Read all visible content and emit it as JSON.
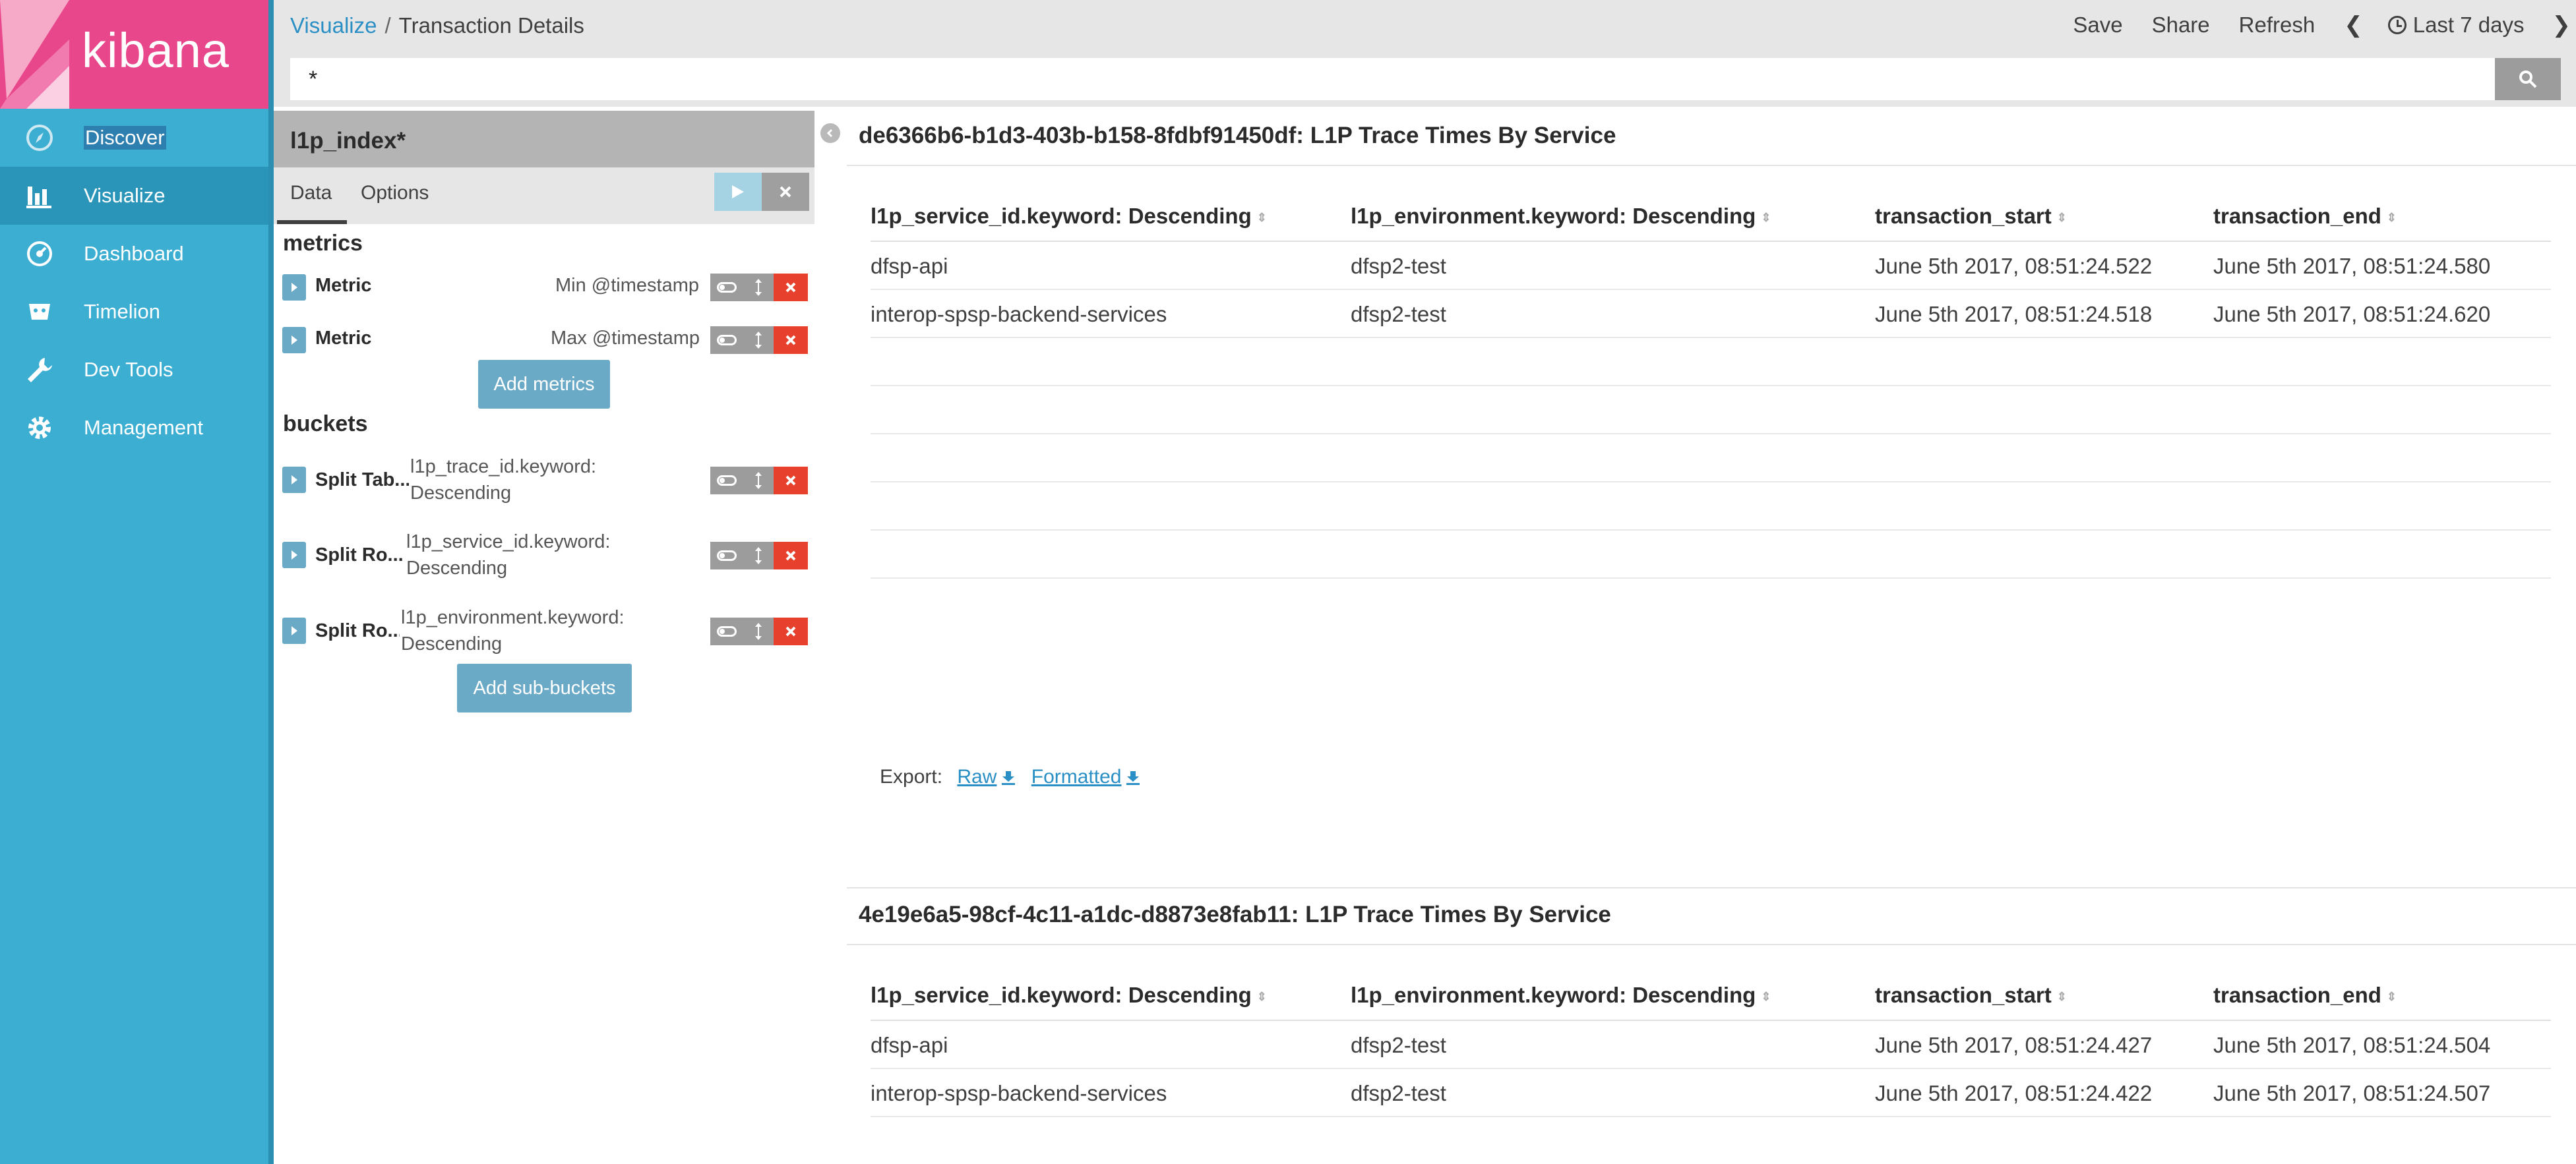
{
  "app": {
    "logo_text": "kibana"
  },
  "nav": {
    "items": [
      {
        "label": "Discover",
        "icon": "compass-icon"
      },
      {
        "label": "Visualize",
        "icon": "bar-chart-icon"
      },
      {
        "label": "Dashboard",
        "icon": "dashboard-icon"
      },
      {
        "label": "Timelion",
        "icon": "timelion-icon"
      },
      {
        "label": "Dev Tools",
        "icon": "wrench-icon"
      },
      {
        "label": "Management",
        "icon": "gear-icon"
      }
    ]
  },
  "breadcrumb": {
    "parent": "Visualize",
    "separator": "/",
    "current": "Transaction Details"
  },
  "toolbar": {
    "save": "Save",
    "share": "Share",
    "refresh": "Refresh",
    "prev": "❮",
    "time": "Last 7 days",
    "next": "❯"
  },
  "query": {
    "value": "*"
  },
  "editor": {
    "index": "l1p_index*",
    "tabs": {
      "data": "Data",
      "options": "Options"
    },
    "metrics_title": "metrics",
    "metrics": [
      {
        "name": "Metric",
        "desc": "Min @timestamp"
      },
      {
        "name": "Metric",
        "desc": "Max @timestamp"
      }
    ],
    "add_metrics": "Add metrics",
    "buckets_title": "buckets",
    "buckets": [
      {
        "name": "Split Tab...",
        "desc1": "l1p_trace_id.keyword:",
        "desc2": "Descending"
      },
      {
        "name": "Split Ro...",
        "desc1": "l1p_service_id.keyword:",
        "desc2": "Descending"
      },
      {
        "name": "Split Ro...",
        "desc1": "l1p_environment.keyword:",
        "desc2": "Descending"
      }
    ],
    "add_buckets": "Add sub-buckets"
  },
  "results": [
    {
      "title": "de6366b6-b1d3-403b-b158-8fdbf91450df: L1P Trace Times By Service",
      "columns": [
        "l1p_service_id.keyword: Descending",
        "l1p_environment.keyword: Descending",
        "transaction_start",
        "transaction_end"
      ],
      "rows": [
        [
          "dfsp-api",
          "dfsp2-test",
          "June 5th 2017, 08:51:24.522",
          "June 5th 2017, 08:51:24.580"
        ],
        [
          "interop-spsp-backend-services",
          "dfsp2-test",
          "June 5th 2017, 08:51:24.518",
          "June 5th 2017, 08:51:24.620"
        ]
      ],
      "export": {
        "label": "Export:",
        "raw": "Raw",
        "formatted": "Formatted"
      }
    },
    {
      "title": "4e19e6a5-98cf-4c11-a1dc-d8873e8fab11: L1P Trace Times By Service",
      "columns": [
        "l1p_service_id.keyword: Descending",
        "l1p_environment.keyword: Descending",
        "transaction_start",
        "transaction_end"
      ],
      "rows": [
        [
          "dfsp-api",
          "dfsp2-test",
          "June 5th 2017, 08:51:24.427",
          "June 5th 2017, 08:51:24.504"
        ],
        [
          "interop-spsp-backend-services",
          "dfsp2-test",
          "June 5th 2017, 08:51:24.422",
          "June 5th 2017, 08:51:24.507"
        ]
      ]
    }
  ]
}
